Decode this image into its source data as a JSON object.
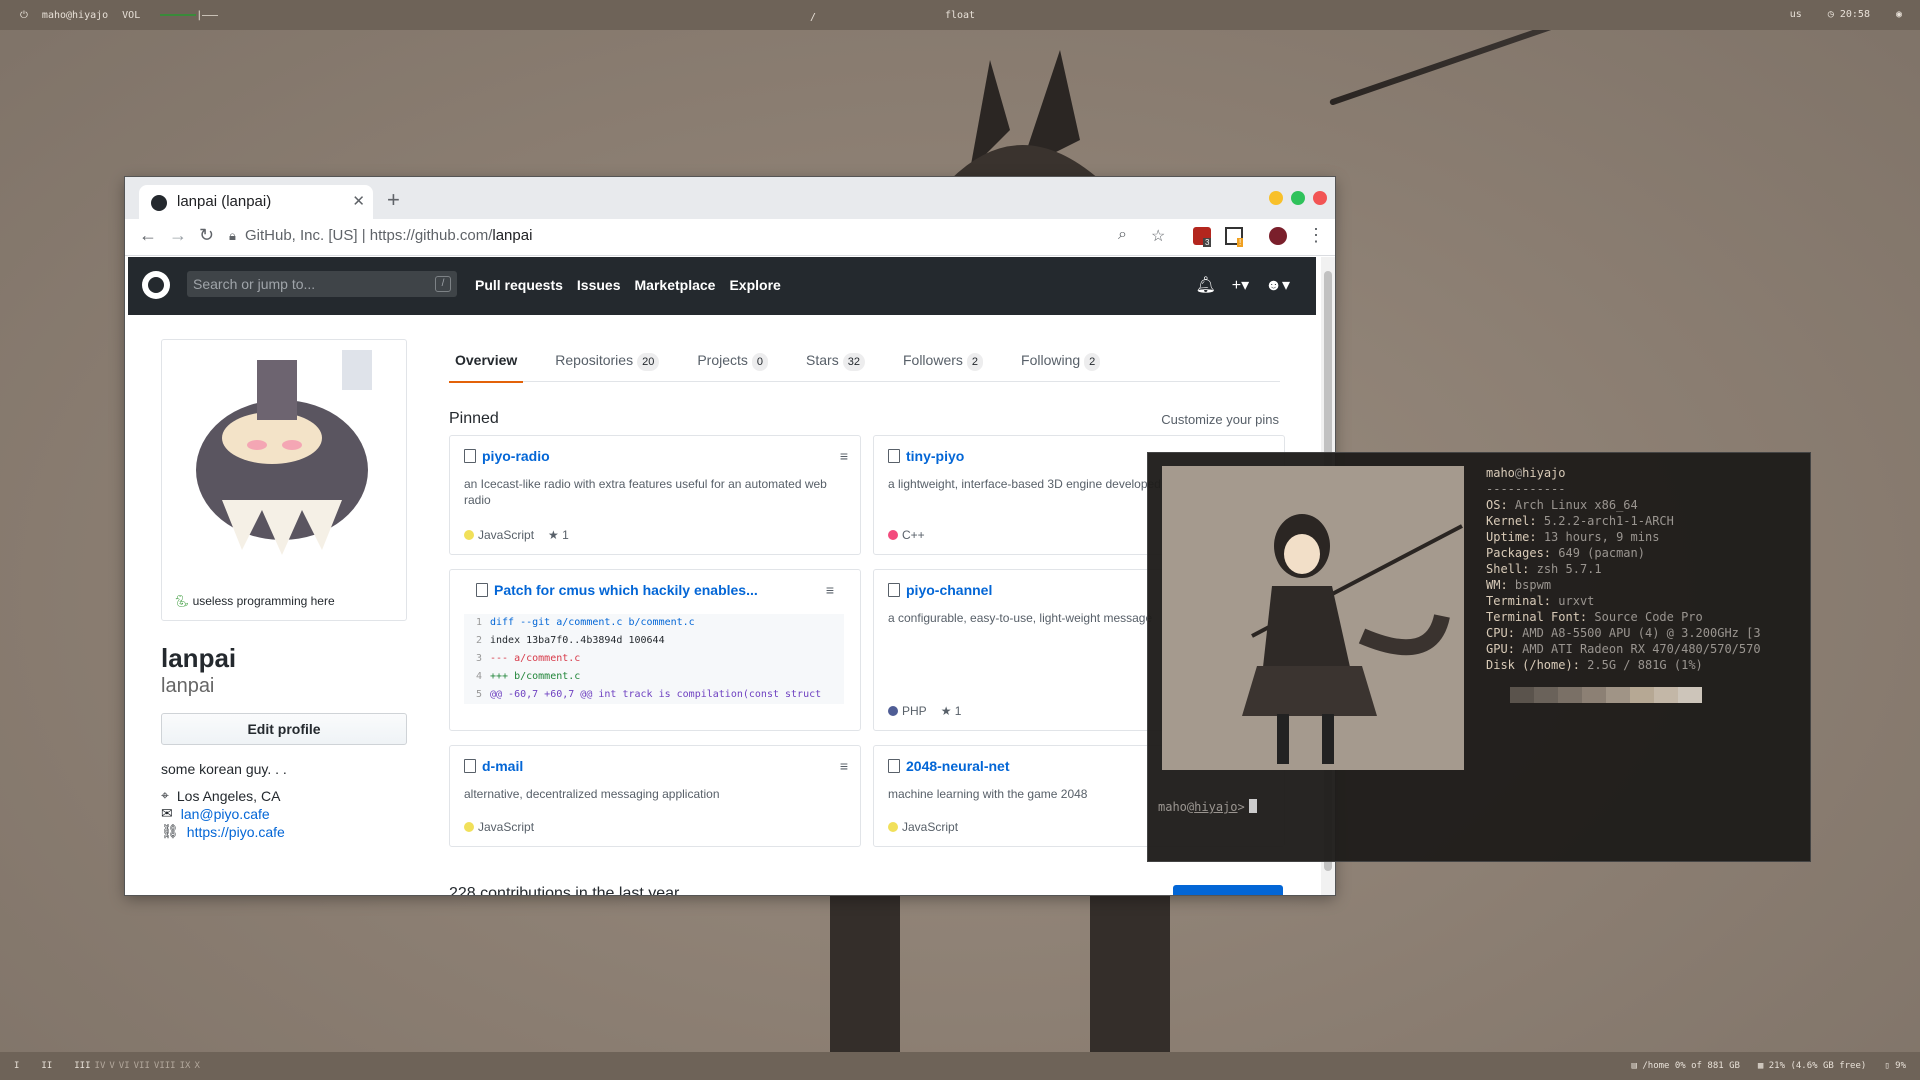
{
  "topbar": {
    "user": "maho@hiyajo",
    "vol_label": "VOL",
    "center_left": "/",
    "center": "float",
    "keyboard": "us",
    "clock": "20:58"
  },
  "bottombar": {
    "workspaces": [
      "I",
      "II",
      "III",
      "IV",
      "V",
      "VI",
      "VII",
      "VIII",
      "IX",
      "X"
    ],
    "disk": "/home 0% of 881 GB",
    "memory": "21% (4.6% GB free)",
    "battery": "9%"
  },
  "browser": {
    "tab_title": "lanpai (lanpai)",
    "cert": "GitHub, Inc. [US]",
    "url_host": "https://github.com/",
    "url_path": "lanpai",
    "ext_badge_1": "3",
    "ext_badge_2": "!"
  },
  "github": {
    "search_placeholder": "Search or jump to...",
    "search_key": "/",
    "nav": [
      "Pull requests",
      "Issues",
      "Marketplace",
      "Explore"
    ],
    "tabs": [
      {
        "label": "Overview",
        "count": ""
      },
      {
        "label": "Repositories",
        "count": "20"
      },
      {
        "label": "Projects",
        "count": "0"
      },
      {
        "label": "Stars",
        "count": "32"
      },
      {
        "label": "Followers",
        "count": "2"
      },
      {
        "label": "Following",
        "count": "2"
      }
    ],
    "status": "useless programming here",
    "name": "lanpai",
    "login": "lanpai",
    "edit_profile": "Edit profile",
    "bio": "some korean guy. . .",
    "location": "Los Angeles, CA",
    "email": "lan@piyo.cafe",
    "website": "https://piyo.cafe",
    "pinned_title": "Pinned",
    "customize": "Customize your pins",
    "cards": [
      {
        "name": "piyo-radio",
        "desc": "an Icecast-like radio with extra features useful for an automated web radio",
        "lang": "JavaScript",
        "lang_color": "#f1e05a",
        "stars": "1"
      },
      {
        "name": "tiny-piyo",
        "desc": "a lightweight, interface-based 3D engine developed",
        "lang": "C++",
        "lang_color": "#f34b7d",
        "stars": ""
      },
      {
        "name": "Patch for cmus which hackily enables...",
        "desc": "",
        "lang": "",
        "lang_color": "",
        "stars": ""
      },
      {
        "name": "piyo-channel",
        "desc": "a configurable, easy-to-use, light-weight message",
        "lang": "PHP",
        "lang_color": "#4F5D95",
        "stars": "1"
      },
      {
        "name": "d-mail",
        "desc": "alternative, decentralized messaging application",
        "lang": "JavaScript",
        "lang_color": "#f1e05a",
        "stars": ""
      },
      {
        "name": "2048-neural-net",
        "desc": "machine learning with the game 2048",
        "lang": "JavaScript",
        "lang_color": "#f1e05a",
        "stars": ""
      }
    ],
    "diff": [
      {
        "n": "1",
        "t": "diff --git a/comment.c b/comment.c"
      },
      {
        "n": "2",
        "t": "index 13ba7f0..4b3894d 100644"
      },
      {
        "n": "3",
        "t": "--- a/comment.c"
      },
      {
        "n": "4",
        "t": "+++ b/comment.c"
      },
      {
        "n": "5",
        "t": "@@ -60,7 +60,7 @@ int track is compilation(const struct"
      }
    ],
    "contrib_peek": "228 contributions in the last year"
  },
  "terminal": {
    "user": "maho",
    "at": "@",
    "host": "hiyajo",
    "sep": "-----------",
    "info": [
      {
        "k": "OS",
        "v": "Arch Linux x86_64"
      },
      {
        "k": "Kernel",
        "v": "5.2.2-arch1-1-ARCH"
      },
      {
        "k": "Uptime",
        "v": "13 hours, 9 mins"
      },
      {
        "k": "Packages",
        "v": "649 (pacman)"
      },
      {
        "k": "Shell",
        "v": "zsh 5.7.1"
      },
      {
        "k": "WM",
        "v": "bspwm"
      },
      {
        "k": "Terminal",
        "v": "urxvt"
      },
      {
        "k": "Terminal Font",
        "v": "Source Code Pro"
      },
      {
        "k": "CPU",
        "v": "AMD A8-5500 APU (4) @ 3.200GHz [3"
      },
      {
        "k": "GPU",
        "v": "AMD ATI Radeon RX 470/480/570/570"
      },
      {
        "k": "Disk (/home)",
        "v": "2.5G / 881G (1%)"
      }
    ],
    "palette": [
      "#5a534c",
      "#6a625a",
      "#7a7066",
      "#8c8074",
      "#a09486",
      "#b6a894",
      "#c3b7a7",
      "#cdc5ba"
    ],
    "prompt_user": "maho",
    "prompt_host": "hiyajo",
    "prompt_sign": ">"
  },
  "colors": {
    "gh_header": "#24292e",
    "link": "#0366d6",
    "accent": "#e36209"
  }
}
